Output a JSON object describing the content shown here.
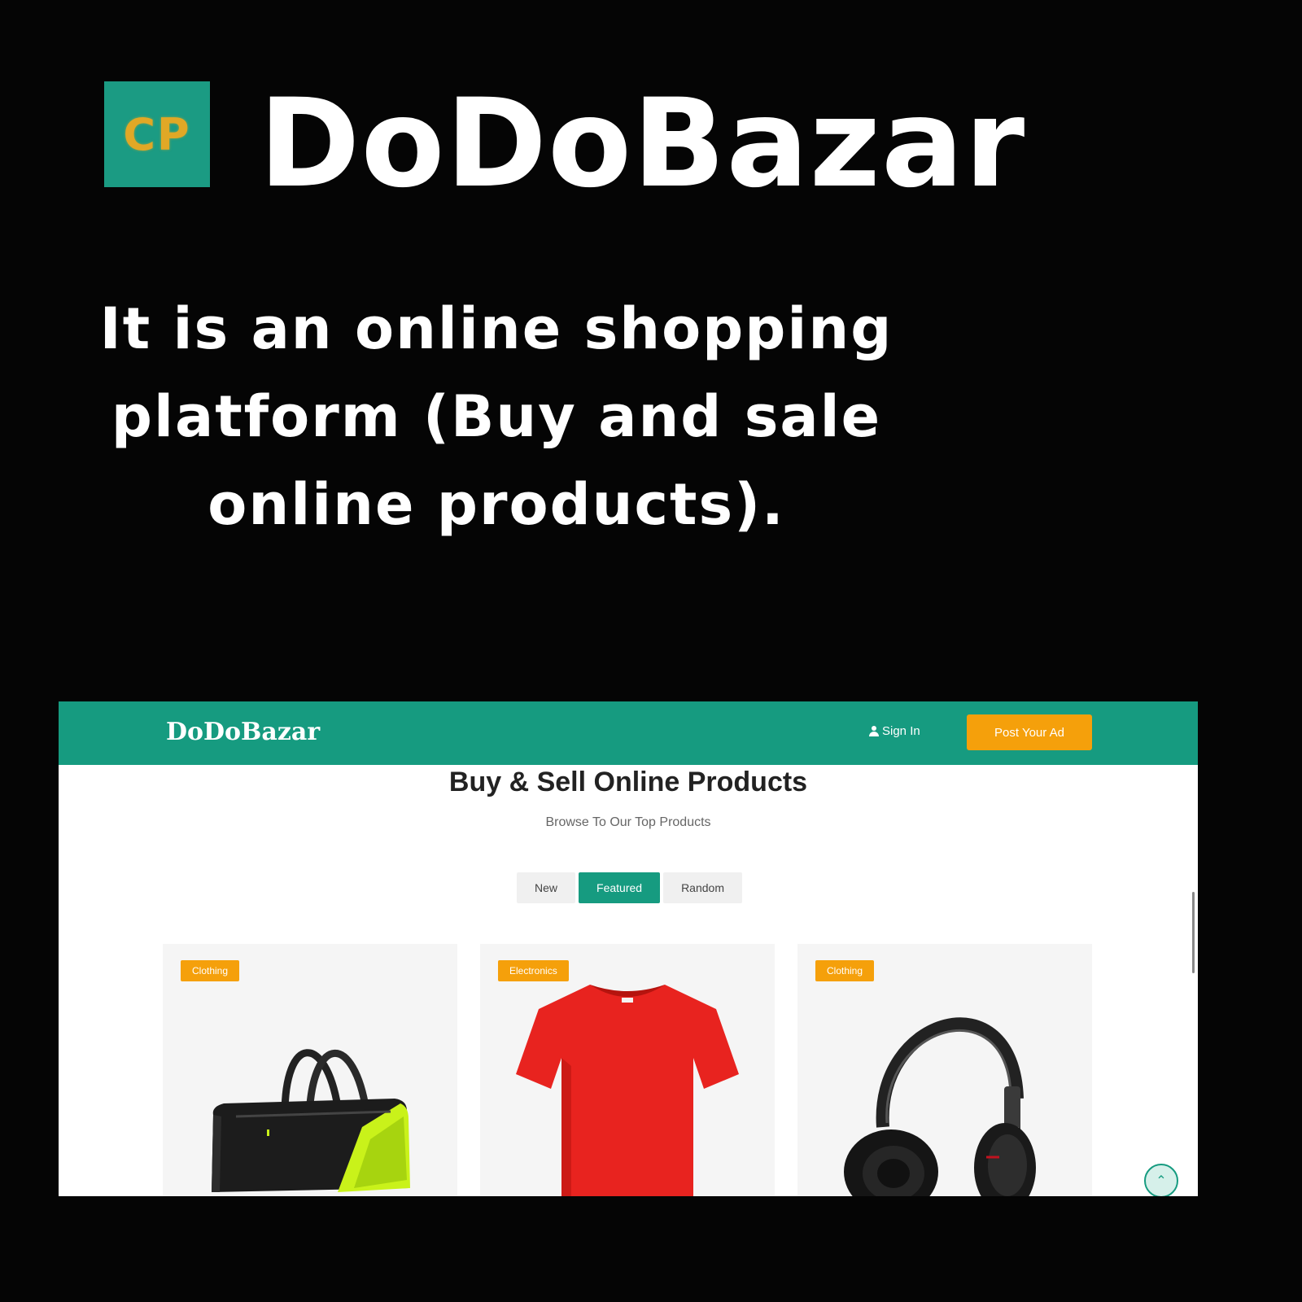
{
  "poster": {
    "logo_text": "CP",
    "brand_title": "DoDoBazar",
    "tagline": "It is an online shopping platform (Buy and sale online products)."
  },
  "navbar": {
    "brand": "DoDoBazar",
    "signin_label": "Sign In",
    "post_ad_label": "Post Your Ad"
  },
  "hero": {
    "title": "Buy & Sell Online Products",
    "subtitle": "Browse To Our Top Products"
  },
  "tabs": [
    {
      "label": "New",
      "active": false
    },
    {
      "label": "Featured",
      "active": true
    },
    {
      "label": "Random",
      "active": false
    }
  ],
  "products": [
    {
      "category": "Clothing",
      "image": "duffel-bag"
    },
    {
      "category": "Electronics",
      "image": "red-tshirt"
    },
    {
      "category": "Clothing",
      "image": "headphones"
    }
  ],
  "colors": {
    "brand_green": "#169b80",
    "accent_orange": "#f5a00b",
    "background": "#050505"
  },
  "icons": {
    "signin": "user-icon",
    "scroll_top": "double-chevron-up-icon"
  }
}
